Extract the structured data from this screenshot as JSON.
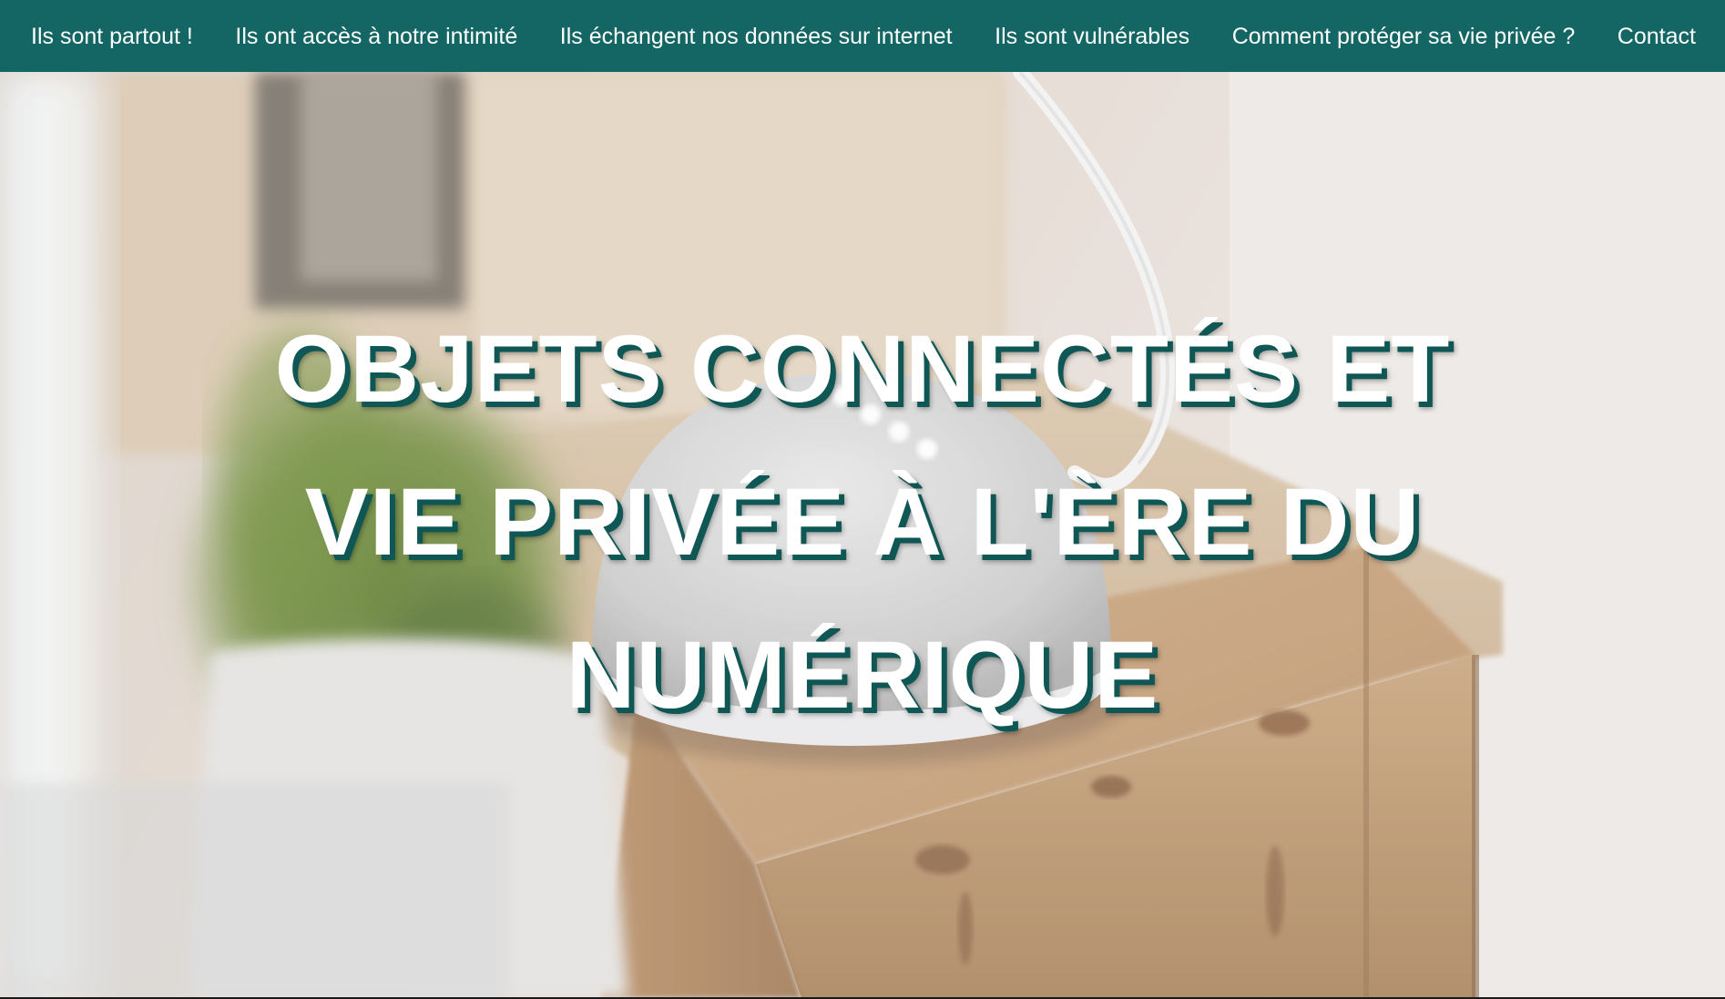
{
  "nav": {
    "items": [
      {
        "label": "Ils sont partout !"
      },
      {
        "label": "Ils ont accès à notre intimité"
      },
      {
        "label": "Ils échangent nos données sur internet"
      },
      {
        "label": "Ils sont vulnérables"
      },
      {
        "label": "Comment protéger sa vie privée ?"
      },
      {
        "label": "Contact"
      }
    ]
  },
  "hero": {
    "title": "OBJETS CONNECTÉS ET VIE PRIVÉE À L'ÈRE DU NUMÉRIQUE",
    "background_image": "smart-speaker-on-wooden-crate-photo"
  },
  "colors": {
    "nav_background": "#136663",
    "nav_text": "#ffffff",
    "title_text": "#ffffff",
    "title_shadow": "#0f5754"
  }
}
